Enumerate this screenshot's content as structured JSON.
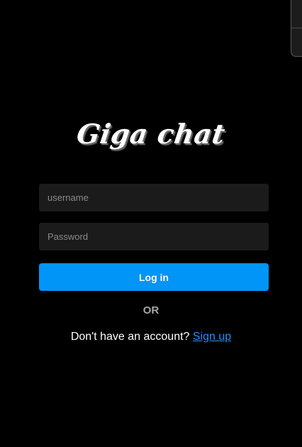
{
  "app": {
    "logo_text": "Giga chat"
  },
  "login_form": {
    "username_placeholder": "username",
    "password_placeholder": "Password",
    "login_label": "Log in"
  },
  "divider": {
    "or_label": "OR"
  },
  "signup": {
    "prompt": "Don't have an account?",
    "link_label": "Sign up"
  },
  "colors": {
    "background": "#000000",
    "input_background": "#1b1b1b",
    "primary_button": "#0095f6",
    "link": "#1e90ff",
    "muted_text": "#a8a8a8"
  }
}
